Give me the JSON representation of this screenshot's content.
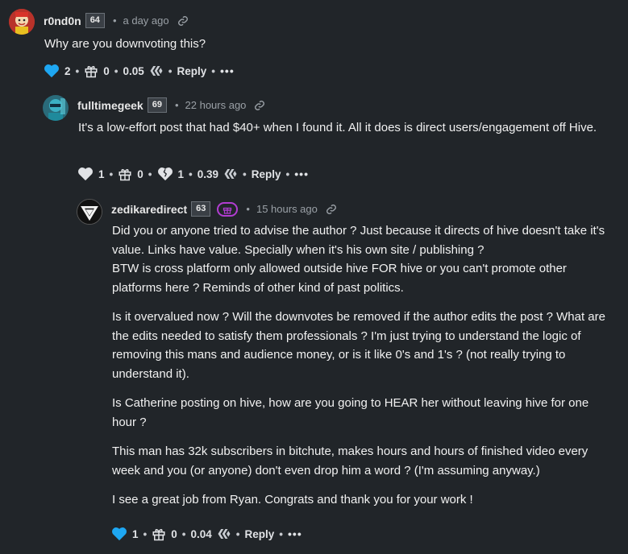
{
  "comments": [
    {
      "author": "r0nd0n",
      "reputation": "64",
      "time": "a day ago",
      "text": [
        "Why are you downvoting this?"
      ],
      "upvotes": "2",
      "gifts": "0",
      "payout": "0.05",
      "reply_label": "Reply",
      "more_label": "•••",
      "upvote_color": "#1ea7f2"
    },
    {
      "author": "fulltimegeek",
      "reputation": "69",
      "time": "22 hours ago",
      "text": [
        "It's a low-effort post that had $40+ when I found it. All it does is direct users/engagement off Hive."
      ],
      "upvotes": "1",
      "gifts": "0",
      "downvotes": "1",
      "payout": "0.39",
      "reply_label": "Reply",
      "more_label": "•••",
      "upvote_color": "#e1e3e6"
    },
    {
      "author": "zedikaredirect",
      "reputation": "63",
      "time": "15 hours ago",
      "text": [
        "Did you or anyone tried to advise the author ? Just because it directs of hive doesn't take it's value. Links have value. Specially when it's his own site / publishing ?",
        "BTW is cross platform only allowed outside hive FOR hive or you can't promote other platforms here ? Reminds of other kind of past politics.",
        "Is it overvalued now ? Will the downvotes be removed if the author edits the post ? What are the edits needed to satisfy them professionals ? I'm just trying to understand the logic of removing this mans and audience money, or is it like 0's and 1's ? (not really trying to understand it).",
        "Is Catherine posting on hive, how are you going to HEAR her without leaving hive for one hour ?",
        "This man has 32k subscribers in bitchute, makes hours and hours of finished video every week and you (or anyone) don't even drop him a word ? (I'm assuming anyway.)",
        "I see a great job from Ryan. Congrats and thank you for your work !"
      ],
      "upvotes": "1",
      "gifts": "0",
      "payout": "0.04",
      "reply_label": "Reply",
      "more_label": "•••",
      "upvote_color": "#1ea7f2",
      "badge_color": "#b13dd1"
    }
  ]
}
